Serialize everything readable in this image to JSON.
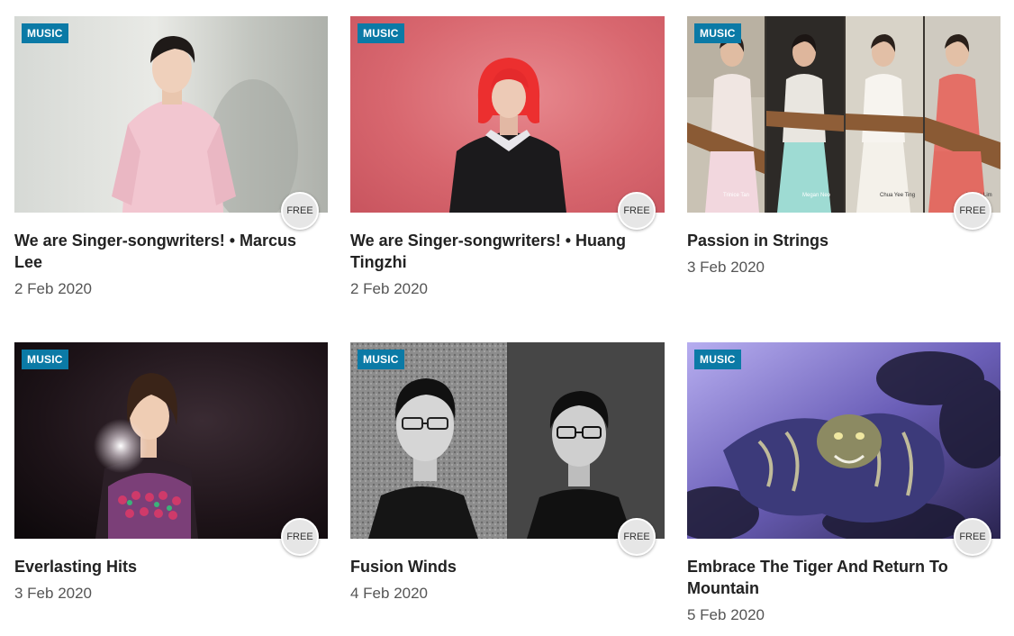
{
  "events": [
    {
      "category": "MUSIC",
      "price_badge": "FREE",
      "title": "We are Singer-songwriters! • Marcus Lee",
      "date": "2 Feb 2020",
      "image": "singer-portrait-pink-sweater"
    },
    {
      "category": "MUSIC",
      "price_badge": "FREE",
      "title": "We are Singer-songwriters! • Huang Tingzhi",
      "date": "2 Feb 2020",
      "image": "singer-portrait-red-hair"
    },
    {
      "category": "MUSIC",
      "price_badge": "FREE",
      "title": "Passion in Strings",
      "date": "3 Feb 2020",
      "image": "four-guzheng-players",
      "image_captions": [
        "Trinice Tan",
        "Megan Neo",
        "Chua Yee Ting",
        "Kenna Lim"
      ]
    },
    {
      "category": "MUSIC",
      "price_badge": "FREE",
      "title": "Everlasting Hits",
      "date": "3 Feb 2020",
      "image": "singer-sequined-dress"
    },
    {
      "category": "MUSIC",
      "price_badge": "FREE",
      "title": "Fusion Winds",
      "date": "4 Feb 2020",
      "image": "two-musicians-bw"
    },
    {
      "category": "MUSIC",
      "price_badge": "FREE",
      "title": "Embrace The Tiger And Return To Mountain",
      "date": "5 Feb 2020",
      "image": "tiger-painting-purple"
    }
  ],
  "colors": {
    "tag_background": "#0b7aa6",
    "title_text": "#222222",
    "date_text": "#555555"
  }
}
